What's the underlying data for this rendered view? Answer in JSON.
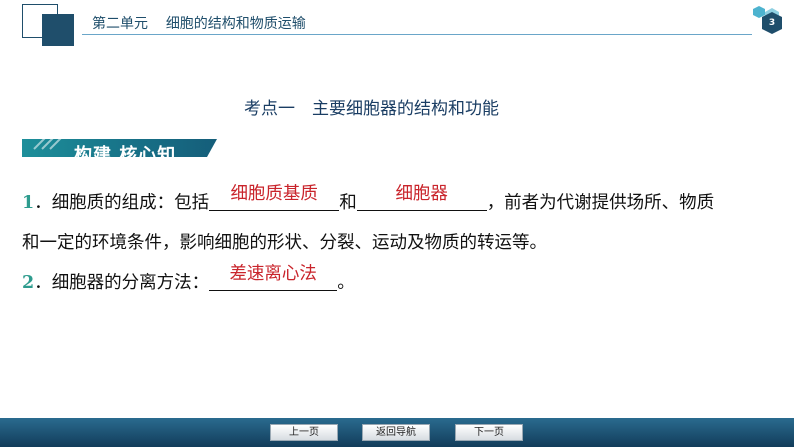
{
  "header": {
    "unit": "第二单元",
    "title": "细胞的结构和物质运输",
    "page_number": "3"
  },
  "section_title": "考点一　主要细胞器的结构和功能",
  "banner_text": "构建 核心知",
  "items": [
    {
      "num": "1",
      "dot": "．",
      "prefix": "细胞质的组成：包括",
      "answer1": "细胞质基质",
      "mid": "和",
      "answer2": "细胞器",
      "suffix": "，前者为代谢提供场所、物质",
      "line2": "和一定的环境条件，影响细胞的形状、分裂、运动及物质的转运等。"
    },
    {
      "num": "2",
      "dot": "．",
      "prefix": "细胞器的分离方法：",
      "answer": "差速离心法",
      "suffix": "。"
    }
  ],
  "nav": {
    "prev": "上一页",
    "home": "返回导航",
    "next": "下一页"
  },
  "colors": {
    "primary": "#1f4e6b",
    "answer_red": "#c9242b",
    "number_teal": "#2e9c8e"
  }
}
